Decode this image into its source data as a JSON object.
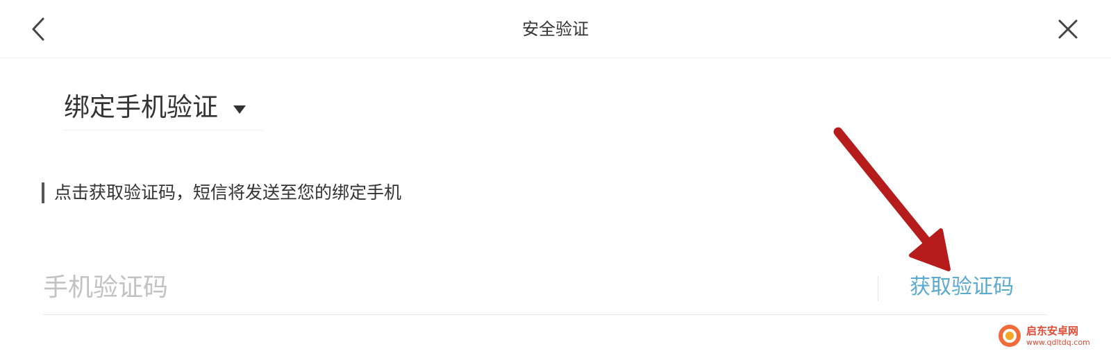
{
  "header": {
    "title": "安全验证",
    "back_icon": "chevron-left-icon",
    "close_icon": "close-icon"
  },
  "verify_method": {
    "label": "绑定手机验证",
    "caret_icon": "caret-down-icon"
  },
  "hint": {
    "text": "点击获取验证码，短信将发送至您的绑定手机"
  },
  "code_field": {
    "value": "",
    "placeholder": "手机验证码",
    "get_code_label": "获取验证码"
  },
  "annotation": {
    "arrow_icon": "red-arrow-icon",
    "arrow_color": "#b71c1c"
  },
  "watermark": {
    "name": "启东安卓网",
    "url": "www.qdltdq.com",
    "logo_icon": "watermark-logo-icon"
  },
  "colors": {
    "link": "#5aa9d0",
    "text": "#333333",
    "placeholder": "#c2c2c2",
    "watermark": "#e24a35"
  }
}
